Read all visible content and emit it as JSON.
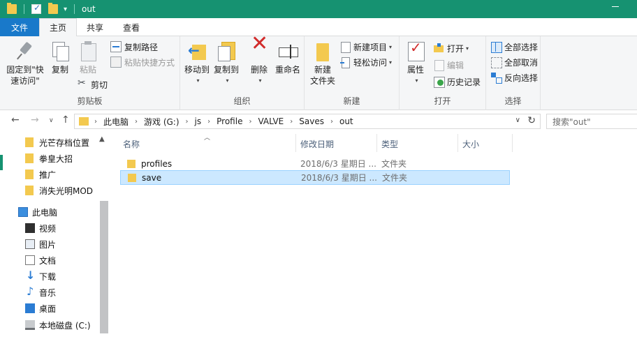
{
  "window": {
    "title": "out",
    "accent": "#169271"
  },
  "tabs": {
    "file": "文件",
    "home": "主页",
    "share": "共享",
    "view": "查看"
  },
  "ribbon": {
    "clipboard": {
      "pin_line1": "固定到\"快",
      "pin_line2": "速访问\"",
      "copy": "复制",
      "paste": "粘贴",
      "copy_path": "复制路径",
      "paste_shortcut": "粘贴快捷方式",
      "cut": "剪切",
      "label": "剪贴板"
    },
    "organize": {
      "move_to": "移动到",
      "copy_to": "复制到",
      "delete": "删除",
      "rename": "重命名",
      "label": "组织"
    },
    "new": {
      "new_folder_line1": "新建",
      "new_folder_line2": "文件夹",
      "new_item": "新建项目",
      "easy_access": "轻松访问",
      "label": "新建"
    },
    "open": {
      "properties": "属性",
      "open": "打开",
      "edit": "编辑",
      "history": "历史记录",
      "label": "打开"
    },
    "select": {
      "select_all": "全部选择",
      "select_none": "全部取消",
      "invert": "反向选择",
      "label": "选择"
    }
  },
  "address": {
    "crumbs": [
      "此电脑",
      "游戏 (G:)",
      "js",
      "Profile",
      "VALVE",
      "Saves",
      "out"
    ],
    "search_placeholder": "搜索\"out\""
  },
  "nav": {
    "quick": [
      "光芒存档位置",
      "拳皇大招",
      "推广",
      "消失光明MOD"
    ],
    "this_pc": "此电脑",
    "pc_items": [
      "视频",
      "图片",
      "文档",
      "下载",
      "音乐",
      "桌面",
      "本地磁盘 (C:)"
    ]
  },
  "columns": {
    "name": "名称",
    "date": "修改日期",
    "type": "类型",
    "size": "大小"
  },
  "files": [
    {
      "name": "profiles",
      "date": "2018/6/3 星期日 ...",
      "type": "文件夹"
    },
    {
      "name": "save",
      "date": "2018/6/3 星期日 ...",
      "type": "文件夹"
    }
  ]
}
